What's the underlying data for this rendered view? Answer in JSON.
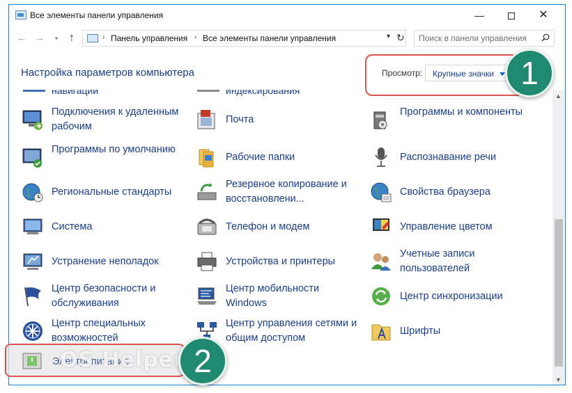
{
  "window": {
    "title": "Все элементы панели управления",
    "minimize": "—",
    "close": "✕"
  },
  "nav": {
    "back": "←",
    "forward": "→",
    "history": "▾",
    "up": "↑",
    "crumbs": [
      "Панель управления",
      "Все элементы панели управления"
    ],
    "crumb_sep": "›",
    "refresh": "↻",
    "dropdown": "▾",
    "search_placeholder": "Поиск в панели управления"
  },
  "header": {
    "title": "Настройка параметров компьютера",
    "view_label": "Просмотр:",
    "view_value": "Крупные значки"
  },
  "cutoff_row": [
    "навигации",
    "индексирования"
  ],
  "items": [
    {
      "label": "Подключения к удаленным рабочим",
      "icon": "remote-desktop-icon"
    },
    {
      "label": "Почта",
      "icon": "mail-icon"
    },
    {
      "label": "Программы и компоненты",
      "icon": "programs-icon"
    },
    {
      "label": "Программы по умолчанию",
      "icon": "default-programs-icon"
    },
    {
      "label": "Рабочие папки",
      "icon": "work-folders-icon"
    },
    {
      "label": "Распознавание речи",
      "icon": "microphone-icon"
    },
    {
      "label": "Региональные стандарты",
      "icon": "region-globe-icon"
    },
    {
      "label": "Резервное копирование и восстановлени...",
      "icon": "backup-icon"
    },
    {
      "label": "Свойства браузера",
      "icon": "browser-properties-icon"
    },
    {
      "label": "Система",
      "icon": "system-monitor-icon"
    },
    {
      "label": "Телефон и модем",
      "icon": "phone-modem-icon"
    },
    {
      "label": "Управление цветом",
      "icon": "color-management-icon"
    },
    {
      "label": "Устранение неполадок",
      "icon": "troubleshoot-icon"
    },
    {
      "label": "Устройства и принтеры",
      "icon": "printer-icon"
    },
    {
      "label": "Учетные записи пользователей",
      "icon": "user-accounts-icon"
    },
    {
      "label": "Центр безопасности и обслуживания",
      "icon": "security-flag-icon"
    },
    {
      "label": "Центр мобильности Windows",
      "icon": "mobility-center-icon"
    },
    {
      "label": "Центр синхронизации",
      "icon": "sync-center-icon"
    },
    {
      "label": "Центр специальных возможностей",
      "icon": "accessibility-icon"
    },
    {
      "label": "Центр управления сетями и общим доступом",
      "icon": "network-center-icon"
    },
    {
      "label": "Шрифты",
      "icon": "fonts-icon"
    }
  ],
  "highlighted_item": {
    "label": "Электропитание",
    "icon": "power-options-icon"
  },
  "callouts": {
    "one": "1",
    "two": "2"
  },
  "watermark": "OS Helper",
  "scroll": {
    "up": "▲",
    "down": "▼"
  },
  "colors": {
    "link": "#1a3e8a",
    "accent": "#1883d7",
    "callout": "#e0524f",
    "badge": "#1f8a6f"
  }
}
